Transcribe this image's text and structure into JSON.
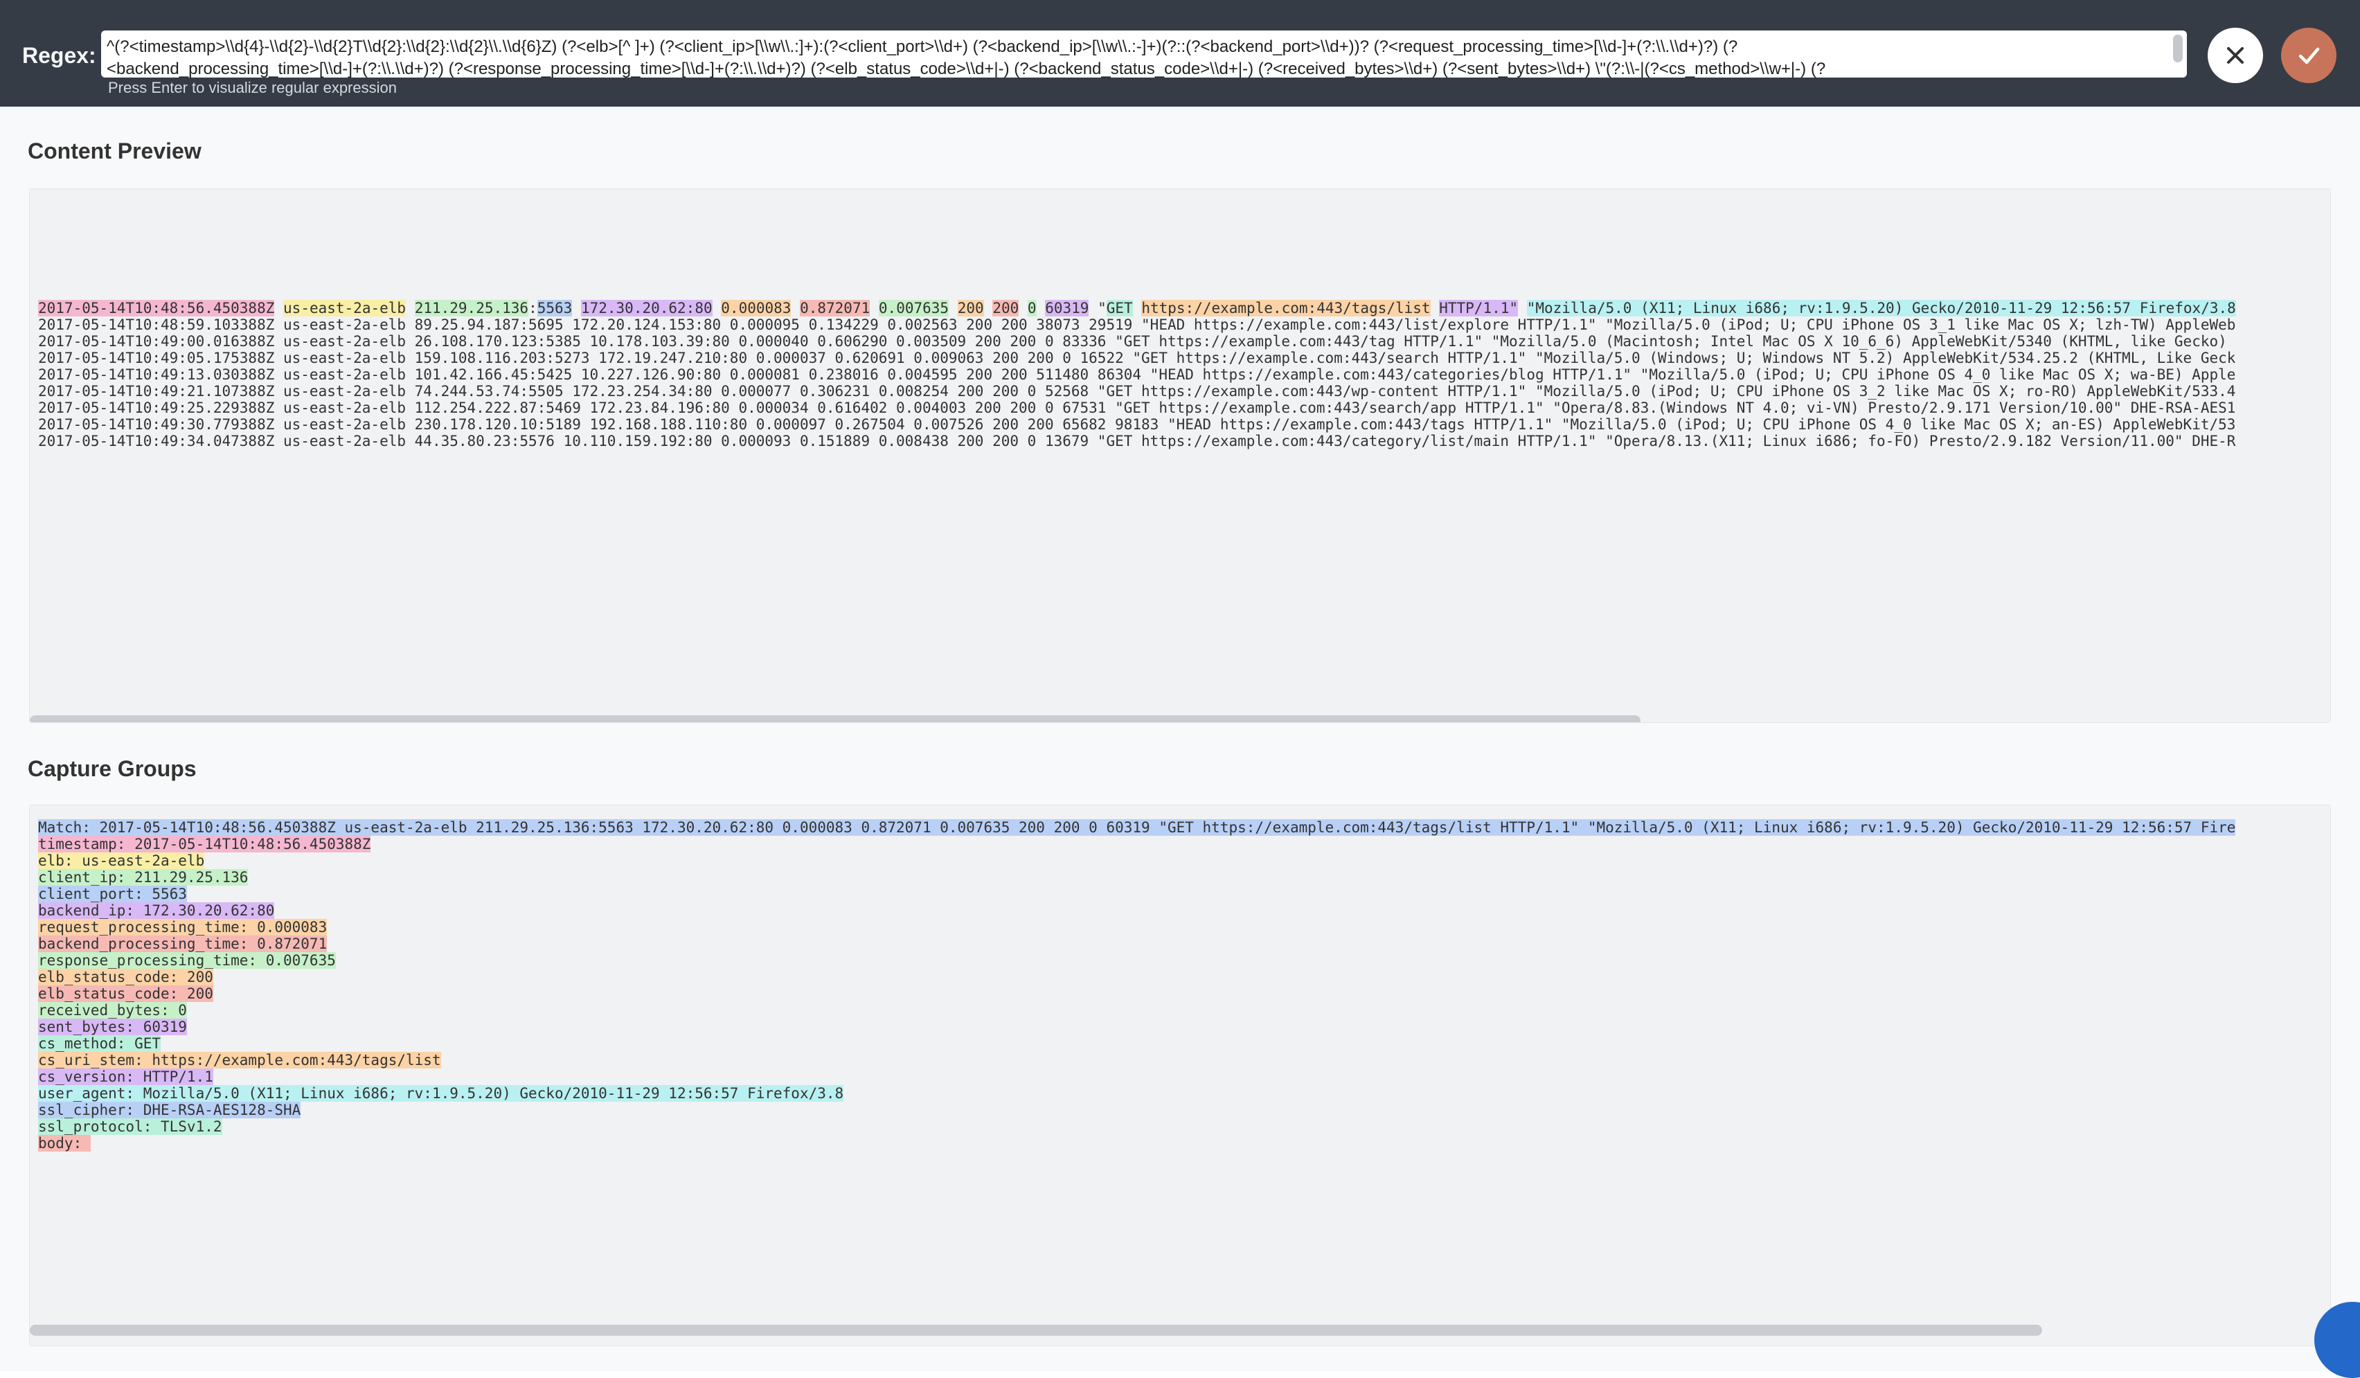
{
  "header": {
    "regex_label": "Regex:",
    "regex_line1": "^(?<timestamp>\\\\d{4}-\\\\d{2}-\\\\d{2}T\\\\d{2}:\\\\d{2}:\\\\d{2}\\\\.\\\\d{6}Z) (?<elb>[^ ]+) (?<client_ip>[\\\\w\\\\.:]+):(?<client_port>\\\\d+) (?<backend_ip>[\\\\w\\\\.:-]+)(?::(?<backend_port>\\\\d+))? (?<request_processing_time>[\\\\d-]+(?:\\\\.\\\\d+)?) (?",
    "regex_line2": "<backend_processing_time>[\\\\d-]+(?:\\\\.\\\\d+)?) (?<response_processing_time>[\\\\d-]+(?:\\\\.\\\\d+)?) (?<elb_status_code>\\\\d+|-) (?<backend_status_code>\\\\d+|-) (?<received_bytes>\\\\d+) (?<sent_bytes>\\\\d+) \\\"(?:\\\\-|(?<cs_method>\\\\w+|-) (?",
    "hint": "Press Enter to visualize regular expression",
    "close_icon": "close-icon",
    "confirm_icon": "checkmark-icon",
    "accent_color": "#c8745a"
  },
  "content_preview": {
    "title": "Content Preview",
    "first_line": {
      "timestamp": "2017-05-14T10:48:56.450388Z",
      "elb": "us-east-2a-elb",
      "client_ip": "211.29.25.136",
      "client_port": "5563",
      "backend": "172.30.20.62:80",
      "req_time": "0.000083",
      "backend_time": "0.872071",
      "resp_time": "0.007635",
      "elb_status": "200",
      "backend_status": "200",
      "received": "0",
      "sent": "60319",
      "quote": "\"",
      "method": "GET",
      "uri": "https://example.com:443/tags/list",
      "version": "HTTP/1.1\"",
      "user_agent": "\"Mozilla/5.0 (X11; Linux i686; rv:1.9.5.20) Gecko/2010-11-29 12:56:57 Firefox/3.8"
    },
    "lines": [
      "2017-05-14T10:48:59.103388Z us-east-2a-elb 89.25.94.187:5695 172.20.124.153:80 0.000095 0.134229 0.002563 200 200 38073 29519 \"HEAD https://example.com:443/list/explore HTTP/1.1\" \"Mozilla/5.0 (iPod; U; CPU iPhone OS 3_1 like Mac OS X; lzh-TW) AppleWeb",
      "2017-05-14T10:49:00.016388Z us-east-2a-elb 26.108.170.123:5385 10.178.103.39:80 0.000040 0.606290 0.003509 200 200 0 83336 \"GET https://example.com:443/tag HTTP/1.1\" \"Mozilla/5.0 (Macintosh; Intel Mac OS X 10_6_6) AppleWebKit/5340 (KHTML, like Gecko)",
      "2017-05-14T10:49:05.175388Z us-east-2a-elb 159.108.116.203:5273 172.19.247.210:80 0.000037 0.620691 0.009063 200 200 0 16522 \"GET https://example.com:443/search HTTP/1.1\" \"Mozilla/5.0 (Windows; U; Windows NT 5.2) AppleWebKit/534.25.2 (KHTML, Like Geck",
      "2017-05-14T10:49:13.030388Z us-east-2a-elb 101.42.166.45:5425 10.227.126.90:80 0.000081 0.238016 0.004595 200 200 511480 86304 \"HEAD https://example.com:443/categories/blog HTTP/1.1\" \"Mozilla/5.0 (iPod; U; CPU iPhone OS 4_0 like Mac OS X; wa-BE) Apple",
      "2017-05-14T10:49:21.107388Z us-east-2a-elb 74.244.53.74:5505 172.23.254.34:80 0.000077 0.306231 0.008254 200 200 0 52568 \"GET https://example.com:443/wp-content HTTP/1.1\" \"Mozilla/5.0 (iPod; U; CPU iPhone OS 3_2 like Mac OS X; ro-RO) AppleWebKit/533.4",
      "2017-05-14T10:49:25.229388Z us-east-2a-elb 112.254.222.87:5469 172.23.84.196:80 0.000034 0.616402 0.004003 200 200 0 67531 \"GET https://example.com:443/search/app HTTP/1.1\" \"Opera/8.83.(Windows NT 4.0; vi-VN) Presto/2.9.171 Version/10.00\" DHE-RSA-AES1",
      "2017-05-14T10:49:30.779388Z us-east-2a-elb 230.178.120.10:5189 192.168.188.110:80 0.000097 0.267504 0.007526 200 200 65682 98183 \"HEAD https://example.com:443/tags HTTP/1.1\" \"Mozilla/5.0 (iPod; U; CPU iPhone OS 4_0 like Mac OS X; an-ES) AppleWebKit/53",
      "2017-05-14T10:49:34.047388Z us-east-2a-elb 44.35.80.23:5576 10.110.159.192:80 0.000093 0.151889 0.008438 200 200 0 13679 \"GET https://example.com:443/category/list/main HTTP/1.1\" \"Opera/8.13.(X11; Linux i686; fo-FO) Presto/2.9.182 Version/11.00\" DHE-R"
    ]
  },
  "capture_groups": {
    "title": "Capture Groups",
    "match_line": "Match: 2017-05-14T10:48:56.450388Z us-east-2a-elb 211.29.25.136:5563 172.30.20.62:80 0.000083 0.872071 0.007635 200 200 0 60319 \"GET https://example.com:443/tags/list HTTP/1.1\" \"Mozilla/5.0 (X11; Linux i686; rv:1.9.5.20) Gecko/2010-11-29 12:56:57 Fire",
    "groups": [
      {
        "text": "timestamp: 2017-05-14T10:48:56.450388Z",
        "color": "pink"
      },
      {
        "text": "elb: us-east-2a-elb",
        "color": "yel"
      },
      {
        "text": "client_ip: 211.29.25.136",
        "color": "grn"
      },
      {
        "text": "client_port: 5563",
        "color": "blue"
      },
      {
        "text": "backend_ip: 172.30.20.62:80",
        "color": "purp"
      },
      {
        "text": "request_processing_time: 0.000083",
        "color": "org"
      },
      {
        "text": "backend_processing_time: 0.872071",
        "color": "red"
      },
      {
        "text": "response_processing_time: 0.007635",
        "color": "grn"
      },
      {
        "text": "elb_status_code: 200",
        "color": "org"
      },
      {
        "text": "elb_status_code: 200",
        "color": "red"
      },
      {
        "text": "received_bytes: 0",
        "color": "grn"
      },
      {
        "text": "sent_bytes: 60319",
        "color": "purp"
      },
      {
        "text": "cs_method: GET",
        "color": "teal"
      },
      {
        "text": "cs_uri_stem: https://example.com:443/tags/list",
        "color": "org"
      },
      {
        "text": "cs_version: HTTP/1.1",
        "color": "purp"
      },
      {
        "text": "user_agent: Mozilla/5.0 (X11; Linux i686; rv:1.9.5.20) Gecko/2010-11-29 12:56:57 Firefox/3.8",
        "color": "cyan"
      },
      {
        "text": "ssl_cipher: DHE-RSA-AES128-SHA",
        "color": "blue"
      },
      {
        "text": "ssl_protocol: TLSv1.2",
        "color": "teal"
      },
      {
        "text": "body: ",
        "color": "red"
      }
    ]
  },
  "chat_icon": "chat-icon"
}
